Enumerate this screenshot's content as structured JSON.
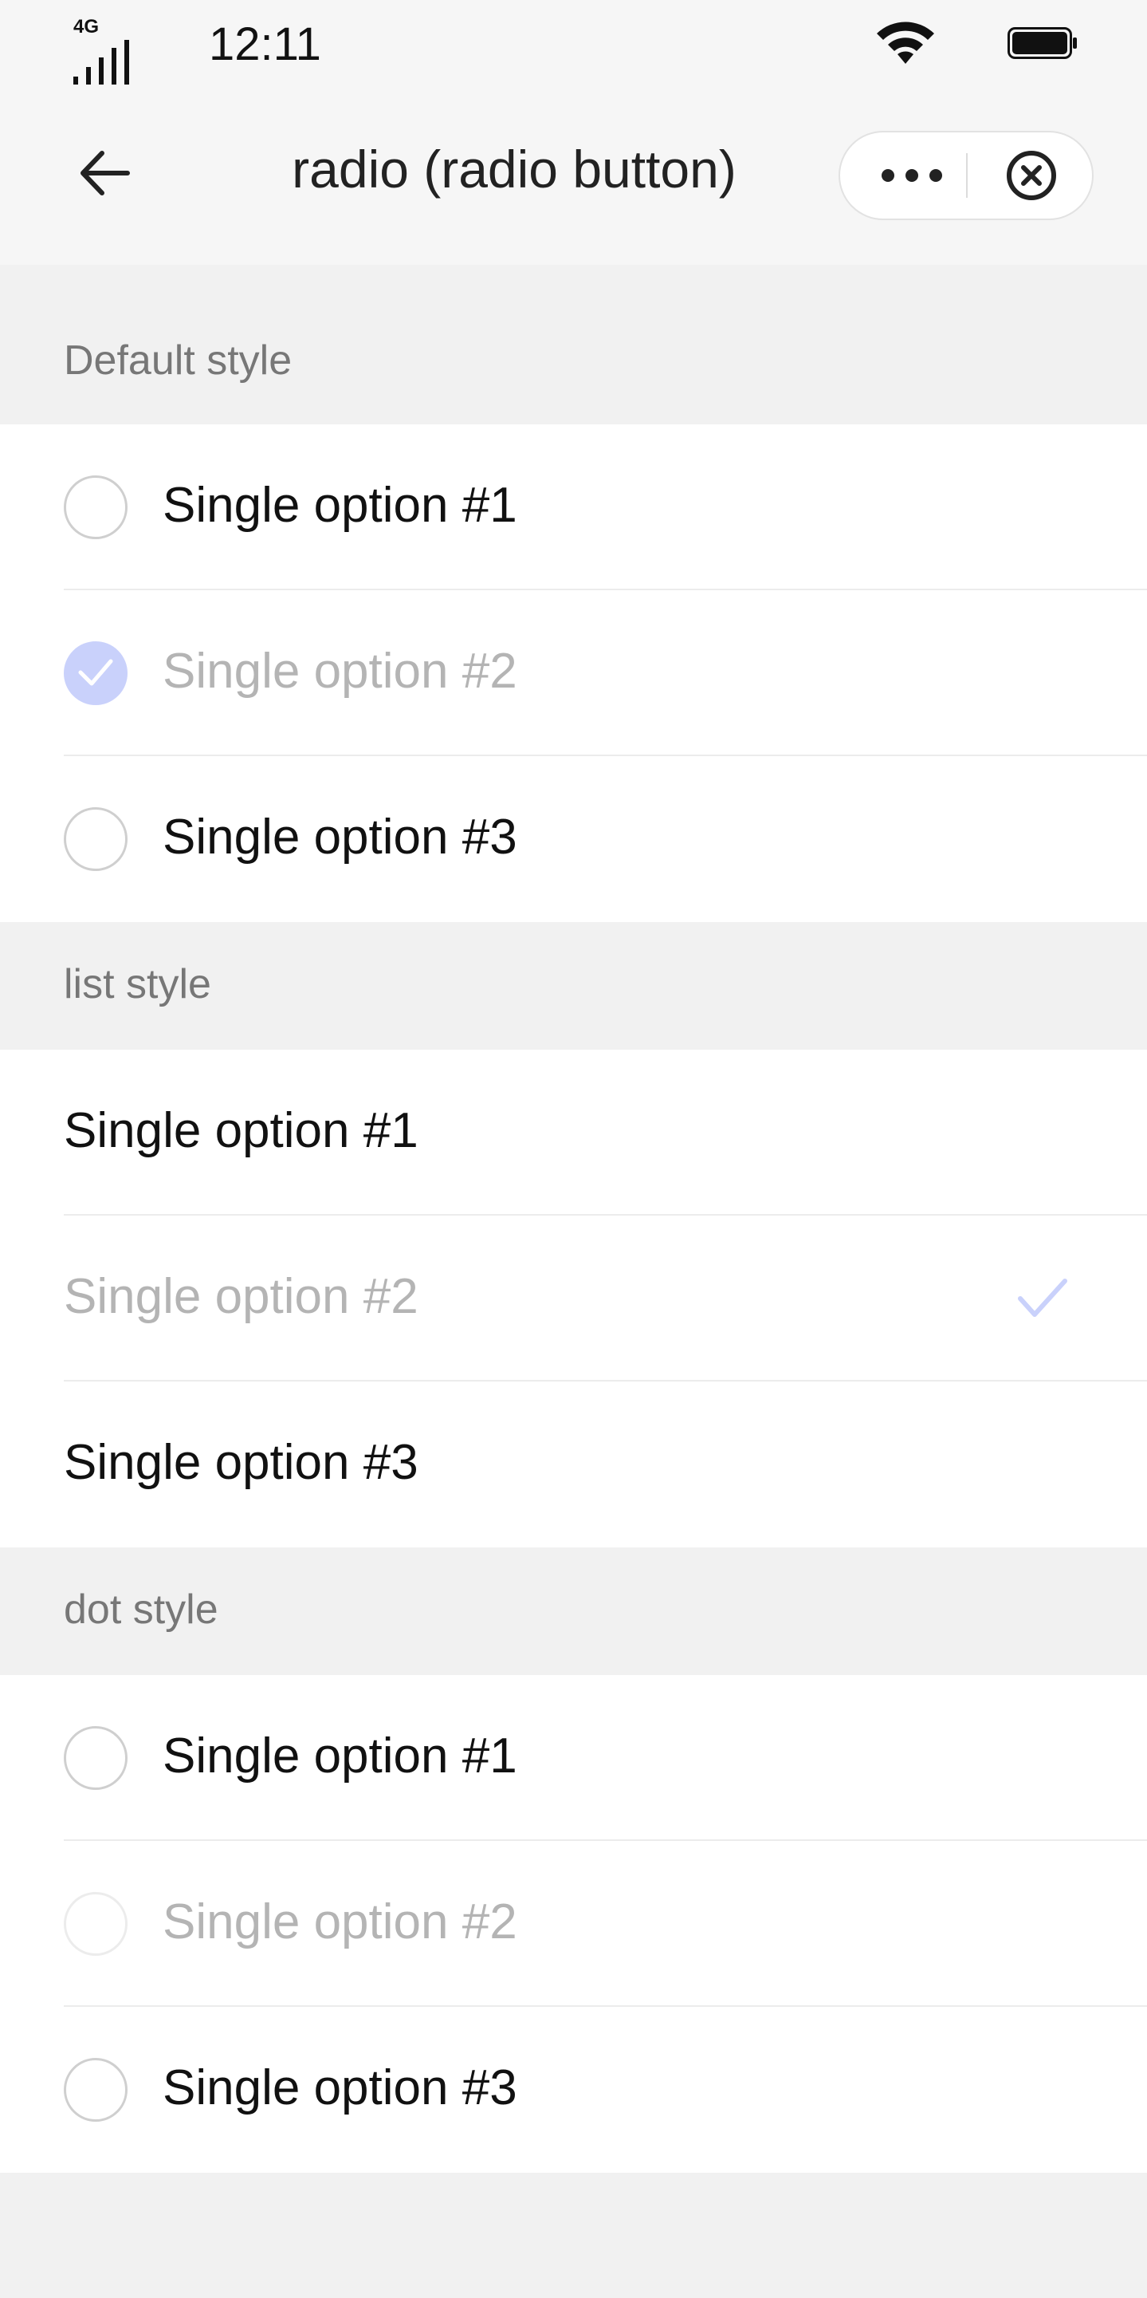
{
  "status_bar": {
    "network": "4G",
    "time": "12:11"
  },
  "nav": {
    "title": "radio (radio button)"
  },
  "sections": [
    {
      "header": "Default style",
      "style": "default",
      "items": [
        {
          "label": "Single option #1",
          "checked": false,
          "disabled": false
        },
        {
          "label": "Single option #2",
          "checked": true,
          "disabled": true
        },
        {
          "label": "Single option #3",
          "checked": false,
          "disabled": false
        }
      ]
    },
    {
      "header": "list style",
      "style": "list",
      "items": [
        {
          "label": "Single option #1",
          "checked": false,
          "disabled": false
        },
        {
          "label": "Single option #2",
          "checked": true,
          "disabled": true
        },
        {
          "label": "Single option #3",
          "checked": false,
          "disabled": false
        }
      ]
    },
    {
      "header": "dot style",
      "style": "dot",
      "items": [
        {
          "label": "Single option #1",
          "checked": false,
          "disabled": false
        },
        {
          "label": "Single option #2",
          "checked": false,
          "disabled": true
        },
        {
          "label": "Single option #3",
          "checked": false,
          "disabled": false
        }
      ]
    }
  ],
  "colors": {
    "accent_disabled": "#c9d1fb",
    "page_background": "#f1f1f1",
    "disabled_text": "#b4b4b4"
  },
  "icons": {
    "back": "arrow-left-icon",
    "more": "ellipsis-icon",
    "close": "circle-x-icon",
    "check": "checkmark-icon"
  }
}
